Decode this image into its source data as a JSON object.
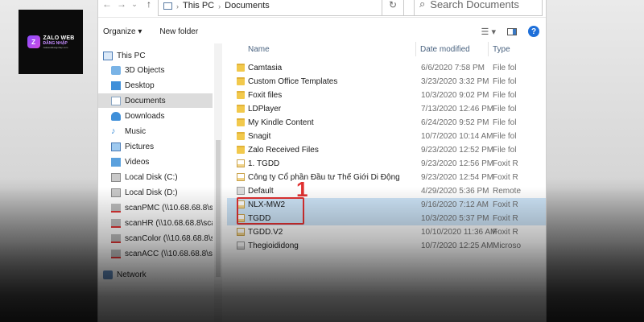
{
  "logo": {
    "title": "ZALO WEB",
    "subtitle": "ĐĂNG NHẬP",
    "url": "zalowebdangnhap.com"
  },
  "address": {
    "path": [
      "This PC",
      "Documents"
    ]
  },
  "search": {
    "placeholder": "Search Documents"
  },
  "toolbar": {
    "organize": "Organize ▾",
    "new_folder": "New folder"
  },
  "nav": [
    {
      "label": "This PC",
      "icon": "pc-icon"
    },
    {
      "label": "3D Objects",
      "icon": "cube-icon"
    },
    {
      "label": "Desktop",
      "icon": "desktop-icon"
    },
    {
      "label": "Documents",
      "icon": "documents-icon",
      "selected": true
    },
    {
      "label": "Downloads",
      "icon": "download-icon"
    },
    {
      "label": "Music",
      "icon": "music-icon"
    },
    {
      "label": "Pictures",
      "icon": "pictures-icon"
    },
    {
      "label": "Videos",
      "icon": "video-icon"
    },
    {
      "label": "Local Disk (C:)",
      "icon": "disk-icon"
    },
    {
      "label": "Local Disk (D:)",
      "icon": "disk-icon"
    },
    {
      "label": "scanPMC (\\\\10.68.68.8\\sca",
      "icon": "network-drive-icon"
    },
    {
      "label": "scanHR (\\\\10.68.68.8\\scan",
      "icon": "network-drive-icon"
    },
    {
      "label": "scanColor (\\\\10.68.68.8\\sc",
      "icon": "network-drive-icon"
    },
    {
      "label": "scanACC (\\\\10.68.68.8\\sc",
      "icon": "network-drive-icon"
    },
    {
      "label": "Network",
      "icon": "network-icon"
    }
  ],
  "columns": {
    "name": "Name",
    "date": "Date modified",
    "type": "Type"
  },
  "files": [
    {
      "name": "Camtasia",
      "date": "6/6/2020 7:58 PM",
      "type": "File fol",
      "kind": "folder"
    },
    {
      "name": "Custom Office Templates",
      "date": "3/23/2020 3:32 PM",
      "type": "File fol",
      "kind": "folder"
    },
    {
      "name": "Foxit files",
      "date": "10/3/2020 9:02 PM",
      "type": "File fol",
      "kind": "folder"
    },
    {
      "name": "LDPlayer",
      "date": "7/13/2020 12:46 PM",
      "type": "File fol",
      "kind": "folder"
    },
    {
      "name": "My Kindle Content",
      "date": "6/24/2020 9:52 PM",
      "type": "File fol",
      "kind": "folder"
    },
    {
      "name": "Snagit",
      "date": "10/7/2020 10:14 AM",
      "type": "File fol",
      "kind": "folder"
    },
    {
      "name": "Zalo Received Files",
      "date": "9/23/2020 12:52 PM",
      "type": "File fol",
      "kind": "folder"
    },
    {
      "name": "1. TGDD",
      "date": "9/23/2020 12:56 PM",
      "type": "Foxit R",
      "kind": "doc"
    },
    {
      "name": "Công ty Cổ phần Đầu tư Thế Giới Di Động",
      "date": "9/23/2020 12:54 PM",
      "type": "Foxit R",
      "kind": "doc"
    },
    {
      "name": "Default",
      "date": "4/29/2020 5:36 PM",
      "type": "Remote",
      "kind": "shortcut"
    },
    {
      "name": "NLX-MW2",
      "date": "9/16/2020 7:12 AM",
      "type": "Foxit R",
      "kind": "doc",
      "selected": true
    },
    {
      "name": "TGDD",
      "date": "10/3/2020 5:37 PM",
      "type": "Foxit R",
      "kind": "doc",
      "selected": true
    },
    {
      "name": "TGDD.V2",
      "date": "10/10/2020 11:36 AM",
      "type": "Foxit R",
      "kind": "doc"
    },
    {
      "name": "Thegioididong",
      "date": "10/7/2020 12:25 AM",
      "type": "Microso",
      "kind": "xml"
    }
  ],
  "annotation": {
    "label": "1",
    "color": "#e03131"
  }
}
